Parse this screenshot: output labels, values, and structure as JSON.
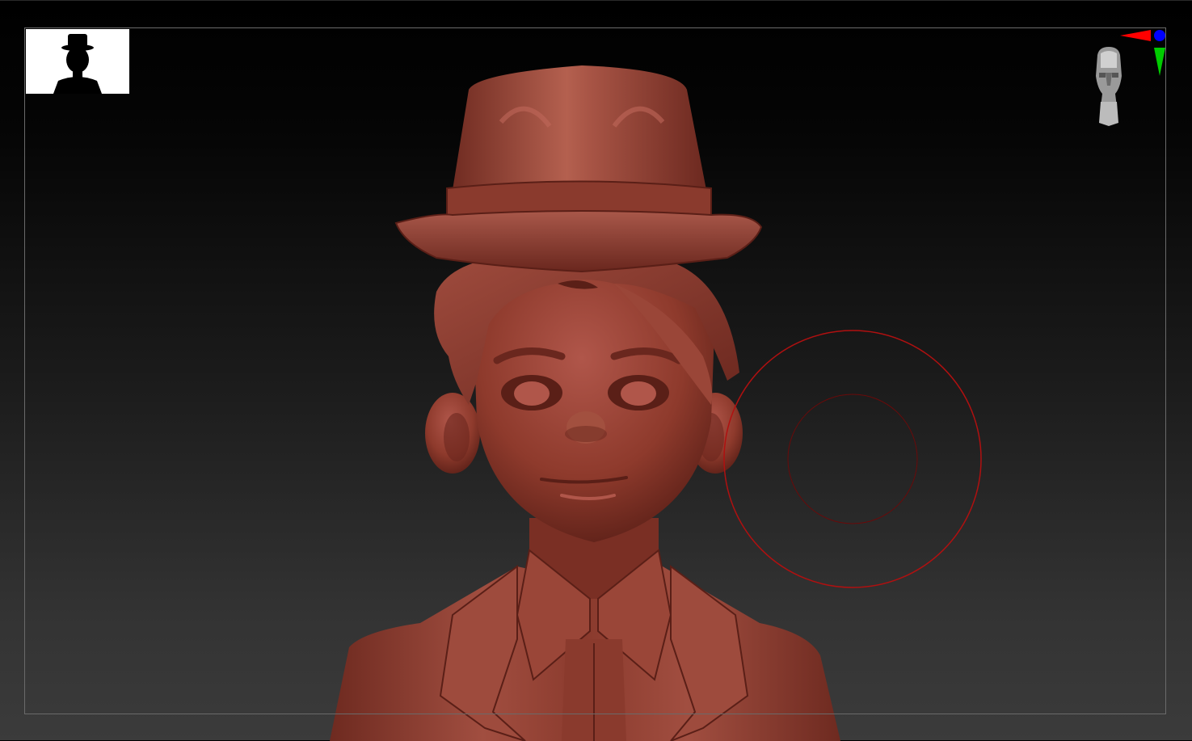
{
  "viewport": {
    "background_top": "#000000",
    "background_bottom": "#3b3b3b",
    "frame_color": "#6a6a6a"
  },
  "model": {
    "material_color": "#8e3a2c",
    "highlight_color": "#c0685a",
    "shadow_color": "#4a1812"
  },
  "brush": {
    "color": "#b01010"
  },
  "axes": {
    "x_color": "#ff0000",
    "y_color": "#00cc00",
    "z_color": "#0000ff"
  },
  "icons": {
    "silhouette": "silhouette-icon",
    "navigation": "head-navigation-icon"
  }
}
